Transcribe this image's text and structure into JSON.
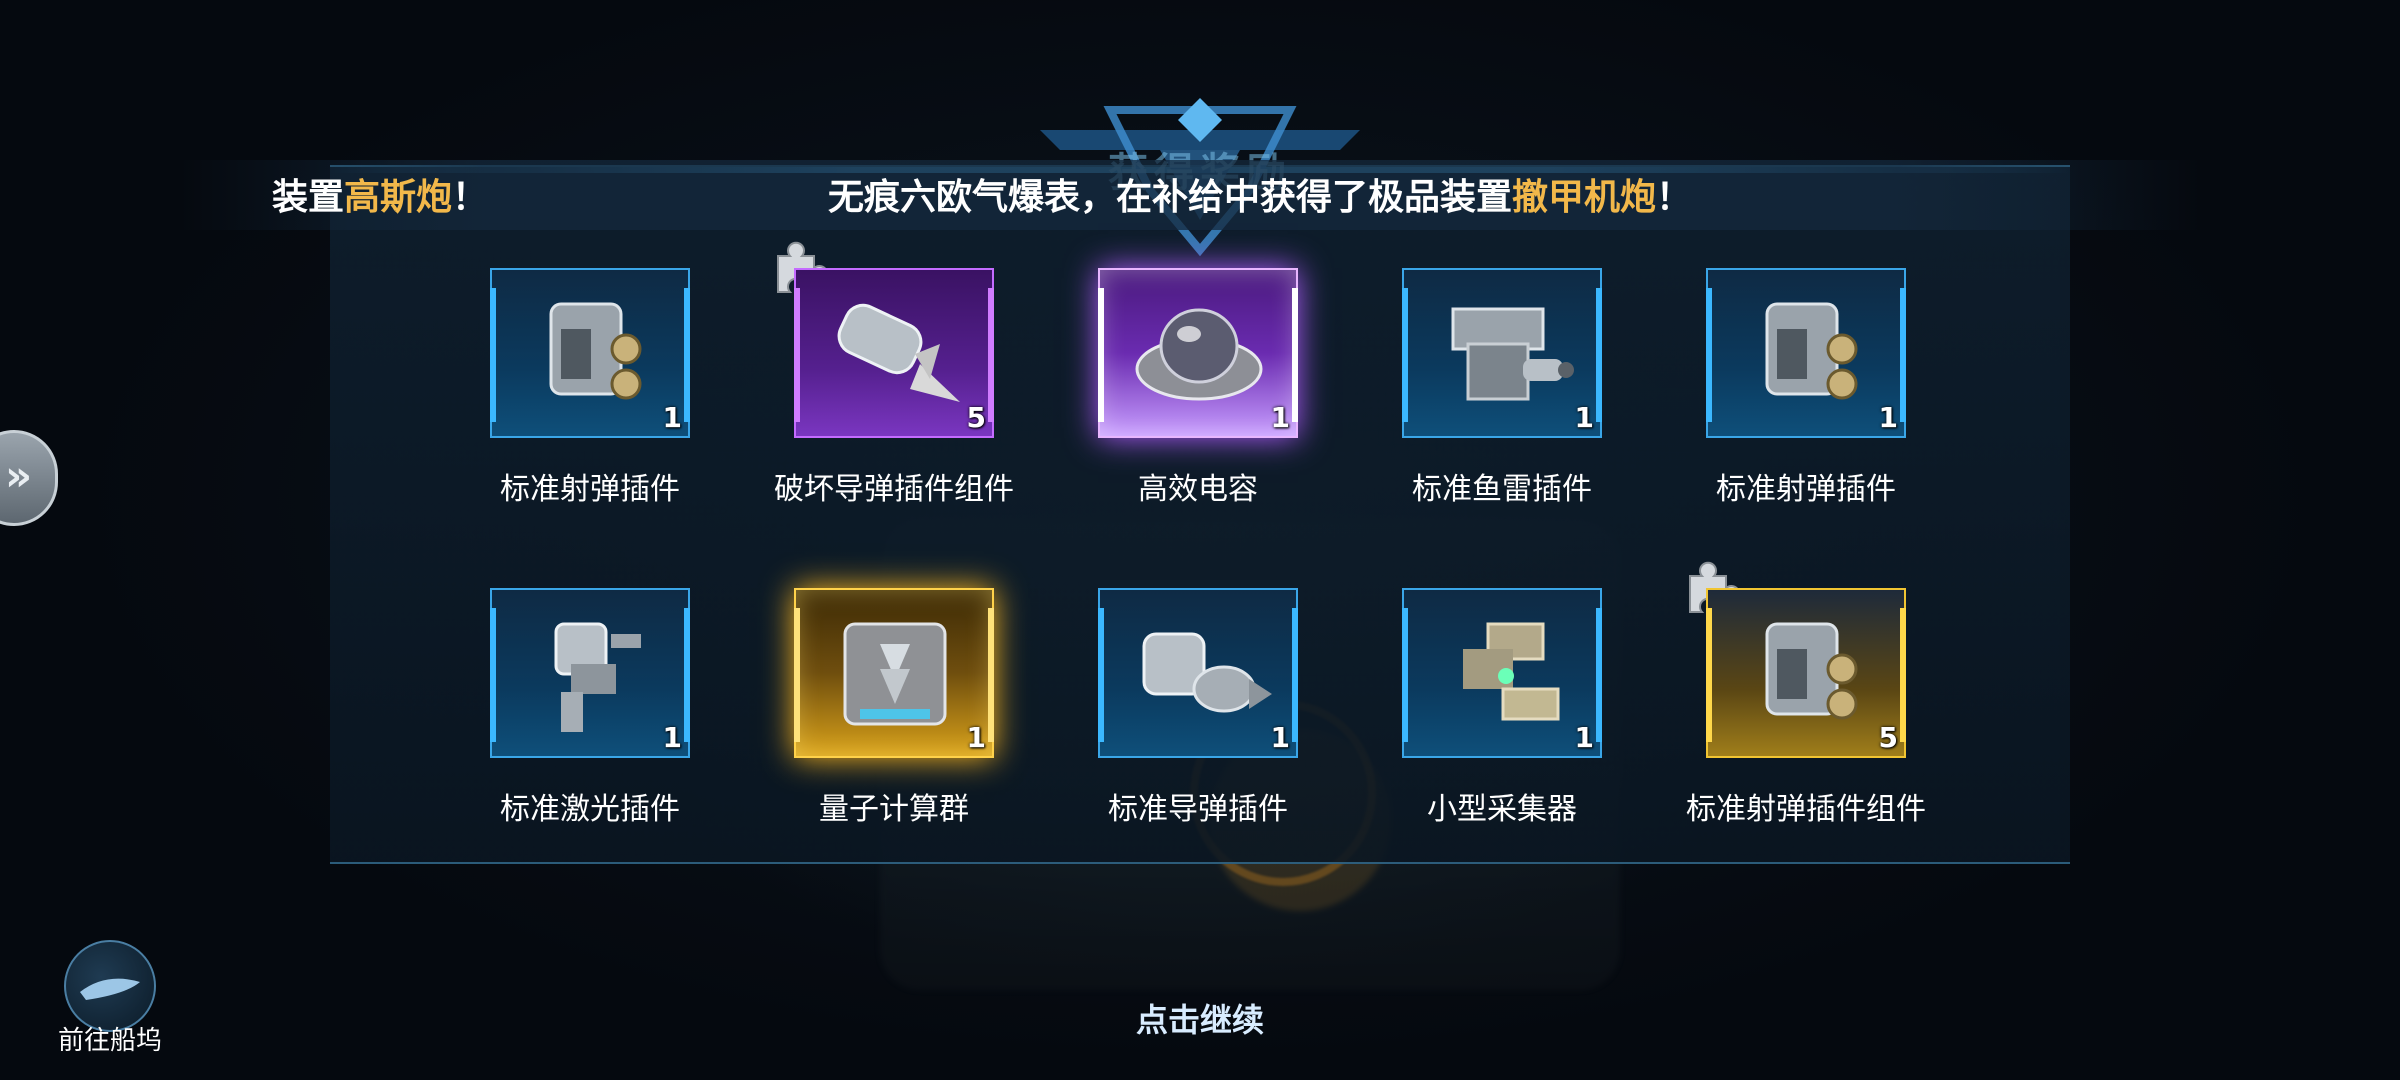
{
  "header": {
    "title": "获得奖励"
  },
  "banner": {
    "left": {
      "prefix": "装置",
      "highlight": "高斯炮",
      "suffix": "！"
    },
    "main": {
      "prefix": "无痕六欧气爆表，在补给中获得了极品装置",
      "highlight": "撤甲机炮",
      "suffix": "！"
    }
  },
  "rewards": [
    {
      "name": "标准射弹插件",
      "count": "1",
      "rarity": "blue",
      "icon": "projectile-plugin-icon"
    },
    {
      "name": "破坏导弹插件组件",
      "count": "5",
      "rarity": "purple",
      "icon": "missile-component-icon",
      "fragment": true
    },
    {
      "name": "高效电容",
      "count": "1",
      "rarity": "purple-glow",
      "icon": "capacitor-icon"
    },
    {
      "name": "标准鱼雷插件",
      "count": "1",
      "rarity": "blue",
      "icon": "torpedo-plugin-icon"
    },
    {
      "name": "标准射弹插件",
      "count": "1",
      "rarity": "blue",
      "icon": "projectile-plugin-icon"
    },
    {
      "name": "标准激光插件",
      "count": "1",
      "rarity": "blue",
      "icon": "laser-plugin-icon"
    },
    {
      "name": "量子计算群",
      "count": "1",
      "rarity": "gold",
      "icon": "quantum-computer-icon"
    },
    {
      "name": "标准导弹插件",
      "count": "1",
      "rarity": "blue",
      "icon": "missile-plugin-icon"
    },
    {
      "name": "小型采集器",
      "count": "1",
      "rarity": "blue",
      "icon": "collector-icon"
    },
    {
      "name": "标准射弹插件组件",
      "count": "5",
      "rarity": "gold-flat",
      "icon": "projectile-component-icon",
      "fragment": true
    }
  ],
  "dock_button": {
    "label": "前往船坞",
    "icon": "ship-icon"
  },
  "continue": {
    "label": "点击继续"
  },
  "colors": {
    "highlight": "#f2b84a",
    "blue_frame": "#3aa6e8",
    "purple_frame": "#c46bff",
    "gold_frame": "#ffd24a"
  }
}
